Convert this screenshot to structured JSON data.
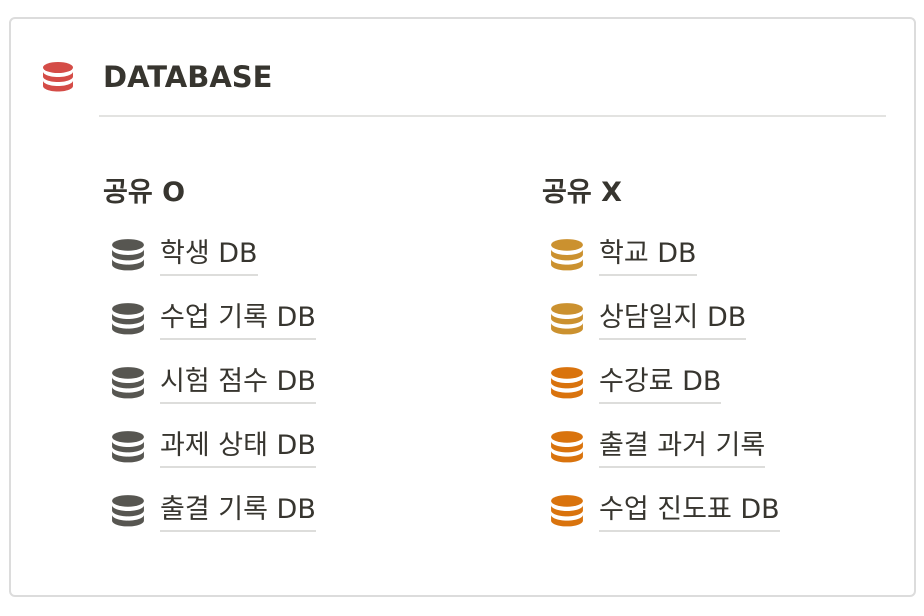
{
  "header": {
    "title": "DATABASE",
    "icon": "database-icon",
    "icon_color": "#d44c47"
  },
  "columns": [
    {
      "title": "공유 O",
      "items": [
        {
          "label": "학생 DB",
          "icon": "database-icon",
          "color": "#575651"
        },
        {
          "label": "수업 기록 DB",
          "icon": "database-icon",
          "color": "#575651"
        },
        {
          "label": "시험 점수 DB",
          "icon": "database-icon",
          "color": "#575651"
        },
        {
          "label": "과제 상태 DB",
          "icon": "database-icon",
          "color": "#575651"
        },
        {
          "label": "출결 기록 DB",
          "icon": "database-icon",
          "color": "#575651"
        }
      ]
    },
    {
      "title": "공유 X",
      "items": [
        {
          "label": "학교 DB",
          "icon": "database-icon",
          "color": "#cb912f"
        },
        {
          "label": "상담일지 DB",
          "icon": "database-icon",
          "color": "#cb912f"
        },
        {
          "label": "수강료 DB",
          "icon": "database-icon",
          "color": "#d9730d"
        },
        {
          "label": "출결 과거 기록",
          "icon": "database-icon",
          "color": "#d9730d"
        },
        {
          "label": "수업 진도표 DB",
          "icon": "database-icon",
          "color": "#d9730d"
        }
      ]
    }
  ]
}
